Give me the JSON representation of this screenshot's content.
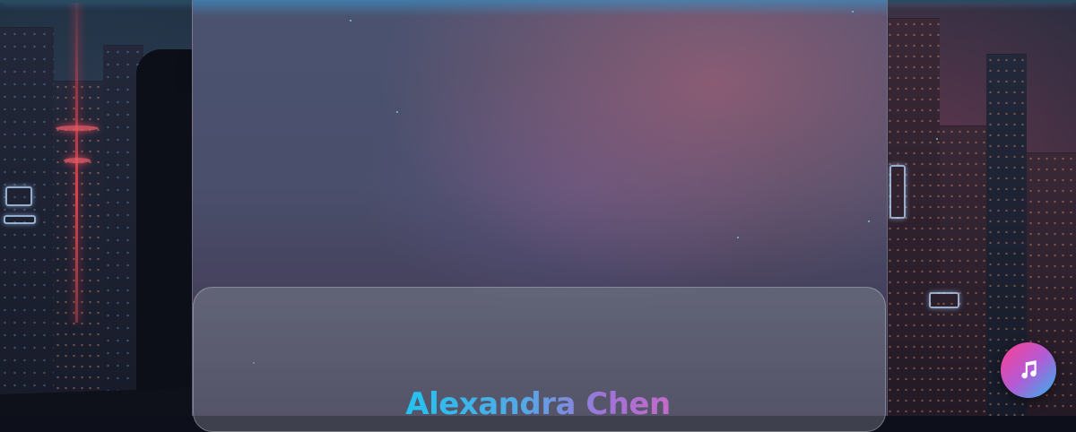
{
  "hero": {
    "name": "Alexandra Chen"
  },
  "music_player": {
    "icon": "music-note-icon"
  },
  "colors": {
    "name_gradient_start": "#22c3f0",
    "name_gradient_end": "#c46ac9",
    "music_button_gradient": [
      "#ff3f8e",
      "#b45ad4",
      "#2fb4f0"
    ]
  }
}
